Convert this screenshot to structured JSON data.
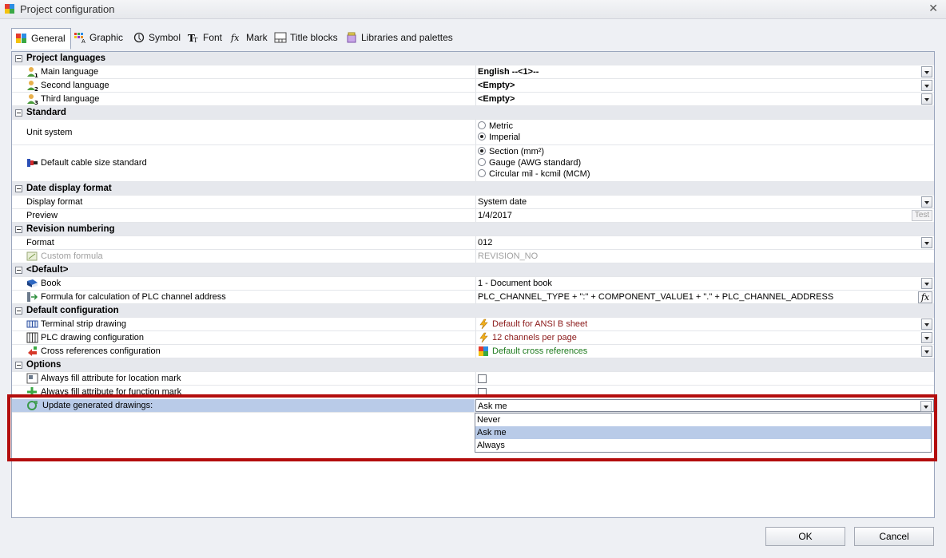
{
  "window": {
    "title": "Project configuration"
  },
  "tabs": [
    {
      "label": "General",
      "icon": "general-icon"
    },
    {
      "label": "Graphic",
      "icon": "graphic-icon"
    },
    {
      "label": "Symbol",
      "icon": "symbol-icon"
    },
    {
      "label": "Font",
      "icon": "font-icon"
    },
    {
      "label": "Mark",
      "icon": "fx-icon"
    },
    {
      "label": "Title blocks",
      "icon": "title-block-icon"
    },
    {
      "label": "Libraries and palettes",
      "icon": "library-icon"
    }
  ],
  "sections": {
    "languages": {
      "title": "Project languages",
      "main_label": "Main language",
      "main_value": "English  --<1>--",
      "second_label": "Second language",
      "second_value": "<Empty>",
      "third_label": "Third language",
      "third_value": "<Empty>"
    },
    "standard": {
      "title": "Standard",
      "unit_label": "Unit system",
      "unit_options": [
        "Metric",
        "Imperial"
      ],
      "unit_selected": "Imperial",
      "cable_label": "Default cable size standard",
      "cable_options": [
        "Section (mm²)",
        "Gauge (AWG standard)",
        "Circular mil - kcmil (MCM)"
      ],
      "cable_selected": "Section (mm²)"
    },
    "date": {
      "title": "Date display format",
      "format_label": "Display format",
      "format_value": "System date",
      "preview_label": "Preview",
      "preview_value": "1/4/2017",
      "test_label": "Test"
    },
    "revision": {
      "title": "Revision numbering",
      "format_label": "Format",
      "format_value": "012",
      "formula_label": "Custom formula",
      "formula_value": "REVISION_NO"
    },
    "default": {
      "title": "<Default>",
      "book_label": "Book",
      "book_value": "1 - Document book",
      "plc_label": "Formula for calculation of PLC channel address",
      "plc_value": "PLC_CHANNEL_TYPE + \":\" + COMPONENT_VALUE1 + \".\" + PLC_CHANNEL_ADDRESS",
      "fx_label": "fx"
    },
    "config": {
      "title": "Default configuration",
      "terminal_label": "Terminal strip drawing",
      "terminal_value": "Default for ANSI B sheet",
      "plc_draw_label": "PLC drawing configuration",
      "plc_draw_value": "12 channels per page",
      "xref_label": "Cross references configuration",
      "xref_value": "Default cross references"
    },
    "options": {
      "title": "Options",
      "location_label": "Always fill attribute for location mark",
      "function_label": "Always fill attribute for function mark",
      "update_label": "Update generated drawings:",
      "update_value": "Ask me",
      "update_options": [
        "Never",
        "Ask me",
        "Always"
      ]
    }
  },
  "buttons": {
    "ok": "OK",
    "cancel": "Cancel"
  },
  "colors": {
    "highlight_box": "#b30d0d",
    "selection": "#b9cbe8",
    "config_value_red": "#8b1a1a",
    "config_value_green": "#1e7b1e"
  }
}
